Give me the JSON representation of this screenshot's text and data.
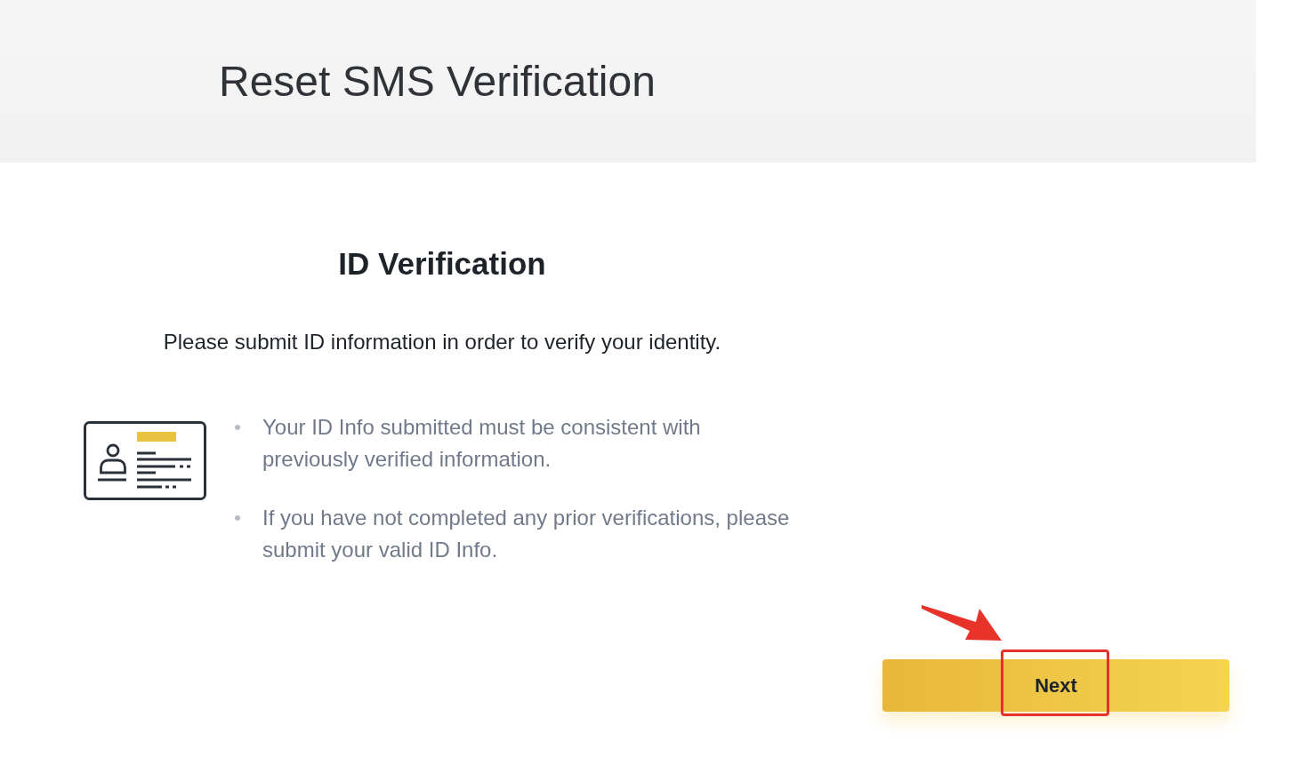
{
  "header": {
    "title": "Reset SMS Verification"
  },
  "section": {
    "title": "ID Verification",
    "description": "Please submit ID information in order to verify your identity.",
    "notes": [
      "Your ID Info submitted must be consistent with previously verified information.",
      "If you have not completed any prior verifications, please submit your valid ID Info."
    ]
  },
  "next_button": {
    "label": "Next",
    "highlighted": true
  }
}
